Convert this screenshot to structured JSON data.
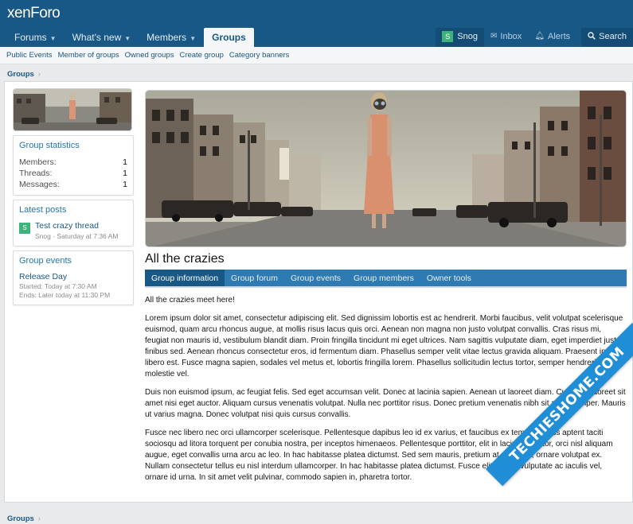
{
  "header": {
    "logo_prefix": "xen",
    "logo_suffix": "Foro",
    "tabs": [
      {
        "label": "Forums",
        "caret": "▼"
      },
      {
        "label": "What's new",
        "caret": "▼"
      },
      {
        "label": "Members",
        "caret": "▼"
      },
      {
        "label": "Groups",
        "caret": ""
      }
    ],
    "user": {
      "initial": "S",
      "name": "Snog"
    },
    "inbox": "Inbox",
    "alerts": "Alerts",
    "search": "Search",
    "icons": {
      "inbox": "envelope-icon",
      "alerts": "bell-icon",
      "search": "search-icon"
    }
  },
  "subnav": [
    "Public Events",
    "Member of groups",
    "Owned groups",
    "Create group",
    "Category banners"
  ],
  "breadcrumb": {
    "label": "Groups",
    "sep": "›"
  },
  "sidebar": {
    "stats": {
      "title": "Group statistics",
      "rows": [
        {
          "label": "Members:",
          "value": "1"
        },
        {
          "label": "Threads:",
          "value": "1"
        },
        {
          "label": "Messages:",
          "value": "1"
        }
      ]
    },
    "latest": {
      "title": "Latest posts",
      "avatar": "S",
      "post_title": "Test crazy thread",
      "post_meta": "Snog · Saturday at 7:36 AM"
    },
    "events": {
      "title": "Group events",
      "name": "Release Day",
      "started": "Started: Today at 7:30 AM",
      "ends": "Ends: Later today at 11:30 PM"
    }
  },
  "group": {
    "title": "All the crazies",
    "tabs": [
      "Group information",
      "Group forum",
      "Group events",
      "Group members",
      "Owner tools"
    ],
    "intro": "All the crazies meet here!",
    "paragraphs": [
      "Lorem ipsum dolor sit amet, consectetur adipiscing elit. Sed dignissim lobortis est ac hendrerit. Morbi faucibus, velit volutpat scelerisque euismod, quam arcu rhoncus augue, at mollis risus lacus quis orci. Aenean non magna non justo volutpat convallis. Cras risus mi, feugiat non mauris id, vestibulum blandit diam. Proin fringilla tincidunt mi eget ultrices. Nam sagittis vulputate diam, eget imperdiet justo finibus sed. Aenean rhoncus consectetur eros, id fermentum diam. Phasellus semper velit vitae lectus gravida aliquam. Praesent in libero est. Fusce magna sapien, sodales vel metus et, lobortis fringilla lorem. Phasellus sollicitudin lectus tortor, semper hendrerit sapien molestie vel.",
      "Duis non euismod ipsum, ac feugiat felis. Sed eget accumsan velit. Donec at lacinia sapien. Aenean ut laoreet diam. Curabitur laoreet sit amet nisi eget auctor. Aliquam cursus venenatis volutpat. Nulla nec porttitor risus. Donec pretium venenatis nibh sit amet semper. Mauris ut varius magna. Donec volutpat nisi quis cursus convallis.",
      "Fusce nec libero nec orci ullamcorper scelerisque. Pellentesque dapibus leo id ex varius, et faucibus ex tempor. Class aptent taciti sociosqu ad litora torquent per conubia nostra, per inceptos himenaeos. Pellentesque porttitor, elit in lacinia porttitor, orci nisl aliquam augue, eget convallis urna arcu ac leo. In hac habitasse platea dictumst. Sed sem mauris, pretium at metus ut, ornare volutpat ex. Nullam consectetur tellus eu nisl interdum ullamcorper. In hac habitasse platea dictumst. Fusce elit ipsum, vulputate ac iaculis vel, ornare id urna. In sit amet velit pulvinar, commodo sapien in, pharetra tortor."
    ]
  },
  "watermark": "TECHIESHOME.COM",
  "colors": {
    "header": "#185886",
    "accent": "#2577b1",
    "avatar": "#3eb37b",
    "watermark": "#1f8ed6"
  }
}
